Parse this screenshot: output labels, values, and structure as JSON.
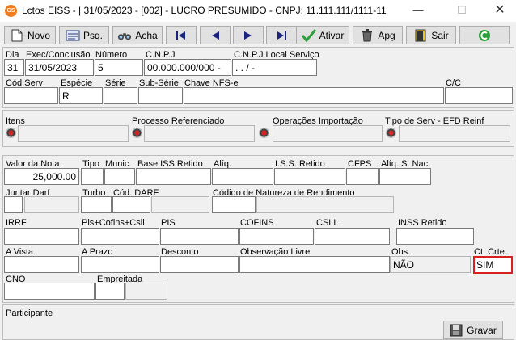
{
  "window": {
    "app_icon": "GS",
    "title": "Lctos EISS - | 31/05/2023 - [002] - LUCRO PRESUMIDO - CNPJ: 11.111.111/1111-11"
  },
  "toolbar": {
    "novo": "Novo",
    "psq": "Psq.",
    "acha": "Acha",
    "ativar": "Ativar",
    "apg": "Apg",
    "sair": "Sair"
  },
  "header": {
    "dia_label": "Dia",
    "dia_value": "31",
    "exec_label": "Exec/Conclusão",
    "exec_value": "31/05/2023",
    "numero_label": "Número",
    "numero_value": "5",
    "cnpj_label": "C.N.P.J",
    "cnpj_value": "00.000.000/000 -",
    "cnpj_local_label": "C.N.P.J Local Serviço",
    "cnpj_local_value": " .   .   /   -",
    "cod_serv_label": "Cód.Serv",
    "especie_label": "Espécie",
    "especie_value": "R",
    "serie_label": "Série",
    "subserie_label": "Sub-Série",
    "chave_label": "Chave NFS-e",
    "cc_label": "C/C"
  },
  "lookups": {
    "itens": "Itens",
    "processo": "Processo Referenciado",
    "operacoes": "Operações Importação",
    "tipo_serv": "Tipo de Serv - EFD Reinf"
  },
  "values": {
    "valor_nota_label": "Valor da Nota",
    "valor_nota_value": "25,000.00",
    "tipo_label": "Tipo",
    "munic_label": "Munic.",
    "base_iss_label": "Base ISS Retido",
    "aliq_label": "Alíq.",
    "iss_retido_label": "I.S.S. Retido",
    "cfps_label": "CFPS",
    "aliq_snac_label": "Alíq. S. Nac.",
    "juntar_darf_label": "Juntar Darf",
    "turbo_label": "Turbo",
    "cod_darf_label": "Cód. DARF",
    "cod_natureza_label": "Código de Natureza de Rendimento",
    "irrf_label": "IRRF",
    "pis_cofins_csll_label": "Pis+Cofins+Csll",
    "pis_label": "PIS",
    "cofins_label": "COFINS",
    "csll_label": "CSLL",
    "inss_label": "INSS Retido",
    "a_vista_label": "A Vista",
    "a_prazo_label": "A Prazo",
    "desconto_label": "Desconto",
    "obs_livre_label": "Observação Livre",
    "obs_label": "Obs.",
    "obs_value": "NÃO",
    "ct_crte_label": "Ct. Crte.",
    "ct_crte_value": "SIM",
    "cno_label": "CNO",
    "empreitada_label": "Empreitada"
  },
  "footer": {
    "participante_label": "Participante",
    "gravar": "Gravar"
  },
  "colors": {
    "highlight": "#d9201f",
    "accent_green": "#2e9e3a",
    "nav_blue": "#1a237e"
  }
}
